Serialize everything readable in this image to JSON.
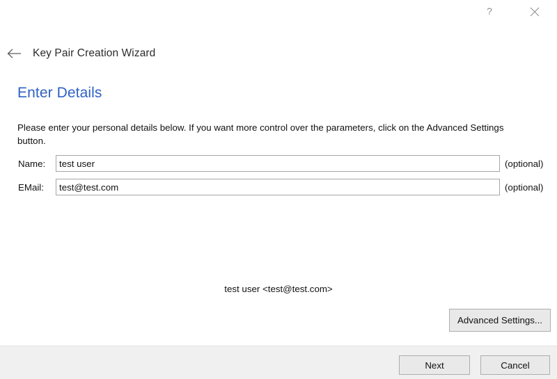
{
  "window": {
    "title": "Key Pair Creation Wizard",
    "help_icon": "question-mark-icon",
    "close_icon": "close-x-icon",
    "back_icon": "back-arrow-icon"
  },
  "page": {
    "heading": "Enter Details",
    "intro": "Please enter your personal details below. If you want more control over the parameters, click on the Advanced Settings button.",
    "heading_color": "#2f61c4"
  },
  "form": {
    "fields": [
      {
        "label": "Name:",
        "value": "test user",
        "placeholder": "",
        "suffix": "(optional)"
      },
      {
        "label": "EMail:",
        "value": "test@test.com",
        "placeholder": "",
        "suffix": "(optional)"
      }
    ]
  },
  "preview": {
    "identity": "test user <test@test.com>"
  },
  "actions": {
    "advanced_settings": "Advanced Settings...",
    "next": "Next",
    "cancel": "Cancel"
  }
}
